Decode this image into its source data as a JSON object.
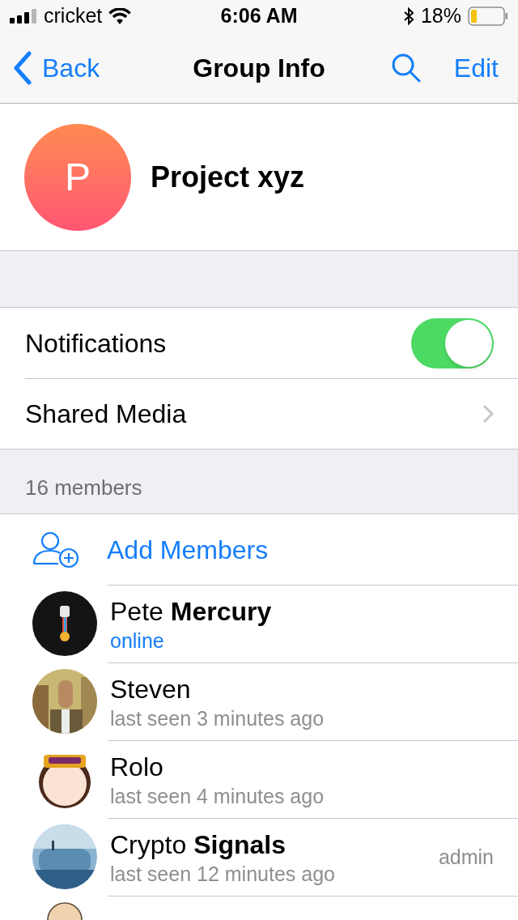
{
  "status_bar": {
    "carrier": "cricket",
    "time": "6:06 AM",
    "battery": "18%"
  },
  "nav": {
    "back": "Back",
    "title": "Group Info",
    "edit": "Edit"
  },
  "group": {
    "initial": "P",
    "name": "Project xyz"
  },
  "settings": [
    {
      "kind": "toggle",
      "label": "Notifications",
      "on": true
    },
    {
      "kind": "link",
      "label": "Shared Media"
    }
  ],
  "members_header": "16 members",
  "add_members": "Add Members",
  "members": [
    {
      "name": "Pete **Mercury**",
      "status": "online",
      "online": true
    },
    {
      "name": "Steven",
      "status": "last seen 3 minutes ago",
      "online": false
    },
    {
      "name": "Rolo",
      "status": "last seen 4 minutes ago",
      "online": false
    },
    {
      "name": "Crypto **Signals**",
      "status": "last seen 12 minutes ago",
      "online": false,
      "role": "admin"
    }
  ]
}
